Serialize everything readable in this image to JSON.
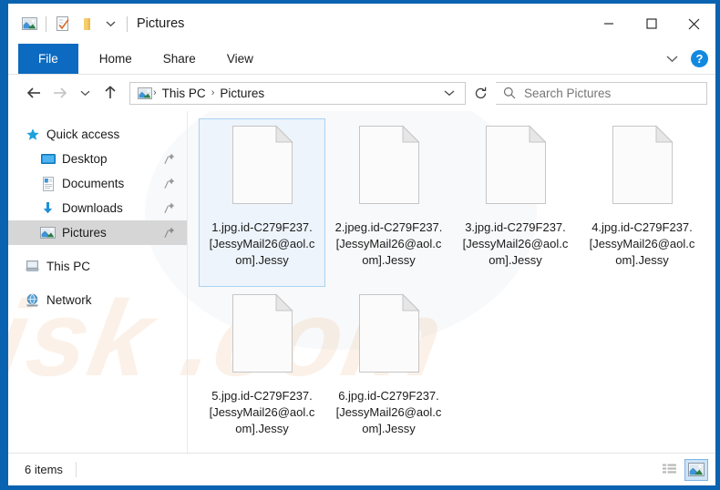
{
  "window": {
    "title": "Pictures",
    "quick_access_toolbar": [
      {
        "name": "picture-icon",
        "tooltip": "Pictures"
      },
      {
        "name": "properties-icon",
        "tooltip": "Properties"
      },
      {
        "name": "new-folder-icon",
        "tooltip": "New folder"
      },
      {
        "name": "chevron-down-icon",
        "tooltip": "Customize Quick Access Toolbar"
      }
    ],
    "controls": {
      "minimize": "–",
      "maximize": "☐",
      "close": "✕"
    },
    "border_color": "#0a63b0"
  },
  "ribbon": {
    "tabs": [
      {
        "label": "File",
        "active": true
      },
      {
        "label": "Home",
        "active": false
      },
      {
        "label": "Share",
        "active": false
      },
      {
        "label": "View",
        "active": false
      }
    ],
    "expand_icon": "chevron-down-icon",
    "help_label": "?",
    "file_tab_color": "#0c6ac0"
  },
  "navigation": {
    "back": {
      "name": "back-arrow-icon",
      "enabled": true
    },
    "forward": {
      "name": "forward-arrow-icon",
      "enabled": false
    },
    "recent": {
      "name": "chevron-down-icon",
      "enabled": true
    },
    "up": {
      "name": "up-arrow-icon",
      "enabled": true
    },
    "refresh": {
      "name": "refresh-icon",
      "enabled": true
    },
    "breadcrumbs": [
      "This PC",
      "Pictures"
    ],
    "breadcrumb_separator": "›",
    "address_icon": "picture-icon",
    "address_chevron": "chevron-down-icon"
  },
  "search": {
    "placeholder": "Search Pictures",
    "value": "",
    "icon": "search-icon"
  },
  "sidebar": {
    "items": [
      {
        "label": "Quick access",
        "icon": "star-icon",
        "child": false,
        "selected": false,
        "pinned": false
      },
      {
        "label": "Desktop",
        "icon": "desktop-icon",
        "child": true,
        "selected": false,
        "pinned": true
      },
      {
        "label": "Documents",
        "icon": "documents-icon",
        "child": true,
        "selected": false,
        "pinned": true
      },
      {
        "label": "Downloads",
        "icon": "downloads-icon",
        "child": true,
        "selected": false,
        "pinned": true
      },
      {
        "label": "Pictures",
        "icon": "picture-icon",
        "child": true,
        "selected": true,
        "pinned": true
      },
      {
        "label": "This PC",
        "icon": "this-pc-icon",
        "child": false,
        "selected": false,
        "pinned": false
      },
      {
        "label": "Network",
        "icon": "network-icon",
        "child": false,
        "selected": false,
        "pinned": false
      }
    ]
  },
  "files": [
    {
      "name": "1.jpg.id-C279F237.[JessyMail26@aol.com].Jessy",
      "icon": "blank-document-icon",
      "selected": true
    },
    {
      "name": "2.jpeg.id-C279F237.[JessyMail26@aol.com].Jessy",
      "icon": "blank-document-icon",
      "selected": false
    },
    {
      "name": "3.jpg.id-C279F237.[JessyMail26@aol.com].Jessy",
      "icon": "blank-document-icon",
      "selected": false
    },
    {
      "name": "4.jpg.id-C279F237.[JessyMail26@aol.com].Jessy",
      "icon": "blank-document-icon",
      "selected": false
    },
    {
      "name": "5.jpg.id-C279F237.[JessyMail26@aol.com].Jessy",
      "icon": "blank-document-icon",
      "selected": false
    },
    {
      "name": "6.jpg.id-C279F237.[JessyMail26@aol.com].Jessy",
      "icon": "blank-document-icon",
      "selected": false
    }
  ],
  "statusbar": {
    "item_count": "6 items",
    "views": [
      {
        "name": "details-view-icon",
        "active": false
      },
      {
        "name": "large-icons-view-icon",
        "active": true
      }
    ]
  },
  "watermark": {
    "text": "risk .com"
  }
}
